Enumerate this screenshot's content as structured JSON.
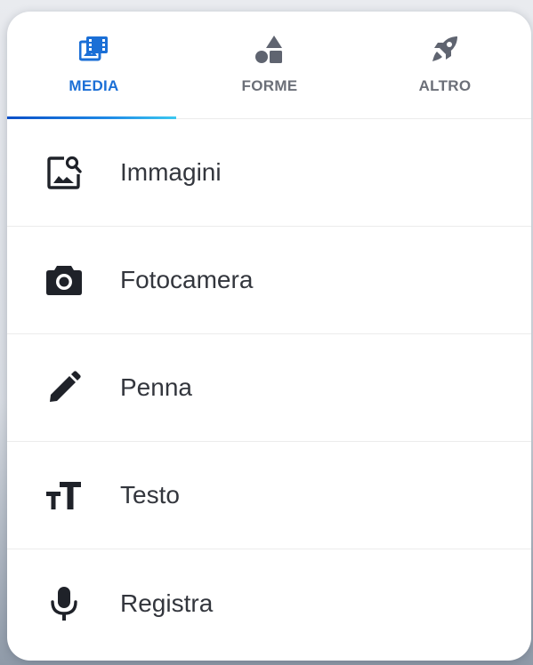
{
  "tabs": [
    {
      "id": "media",
      "label": "MEDIA",
      "icon": "photo-library-icon",
      "active": true
    },
    {
      "id": "forme",
      "label": "FORME",
      "icon": "shapes-icon",
      "active": false
    },
    {
      "id": "altro",
      "label": "ALTRO",
      "icon": "rocket-icon",
      "active": false
    }
  ],
  "items": [
    {
      "label": "Immagini",
      "icon": "image-search-icon"
    },
    {
      "label": "Fotocamera",
      "icon": "camera-icon"
    },
    {
      "label": "Penna",
      "icon": "pencil-icon"
    },
    {
      "label": "Testo",
      "icon": "text-size-icon"
    },
    {
      "label": "Registra",
      "icon": "microphone-icon"
    }
  ],
  "colors": {
    "accent": "#1b6fd6",
    "tab_inactive": "#6b6f78",
    "icon_dark": "#1f2229",
    "text": "#33363d"
  }
}
